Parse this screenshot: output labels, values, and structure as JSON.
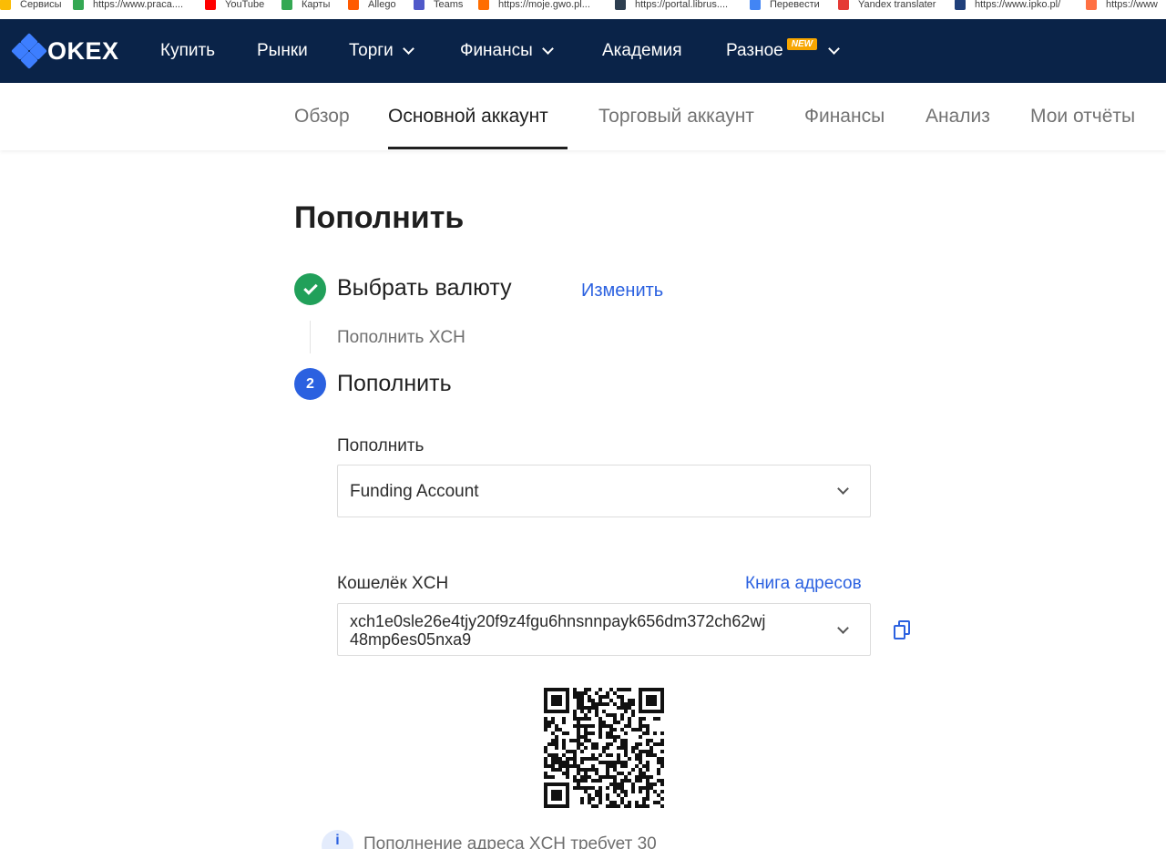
{
  "bookmarks": [
    {
      "label": "Сервисы",
      "color": "#fbbc05",
      "icon": "apps-icon"
    },
    {
      "label": "https://www.praca....",
      "color": "#34a853",
      "icon": "page-icon"
    },
    {
      "label": "YouTube",
      "color": "#ff0000",
      "icon": "youtube-icon"
    },
    {
      "label": "Карты",
      "color": "#34a853",
      "icon": "maps-icon"
    },
    {
      "label": "Allego",
      "color": "#ff5a00",
      "icon": "allegro-icon"
    },
    {
      "label": "Teams",
      "color": "#5059c9",
      "icon": "teams-icon"
    },
    {
      "label": "https://moje.gwo.pl...",
      "color": "#ff6d00",
      "icon": "page-icon"
    },
    {
      "label": "https://portal.librus....",
      "color": "#2d3e50",
      "icon": "page-icon"
    },
    {
      "label": "Перевести",
      "color": "#4285f4",
      "icon": "translate-icon"
    },
    {
      "label": "Yandex translater",
      "color": "#e53935",
      "icon": "yandex-icon"
    },
    {
      "label": "https://www.ipko.pl/",
      "color": "#1f3f7a",
      "icon": "page-icon"
    },
    {
      "label": "https://www",
      "color": "#ff7043",
      "icon": "page-icon"
    }
  ],
  "brand": {
    "logo_text": "OKEX",
    "accent": "#3d7eff",
    "nav_bg": "#0a2348"
  },
  "topnav": {
    "items": [
      {
        "label": "Купить",
        "has_dropdown": false
      },
      {
        "label": "Рынки",
        "has_dropdown": false
      },
      {
        "label": "Торги",
        "has_dropdown": true
      },
      {
        "label": "Финансы",
        "has_dropdown": true
      },
      {
        "label": "Академия",
        "has_dropdown": false
      },
      {
        "label": "Разное",
        "has_dropdown": true,
        "badge": "NEW"
      }
    ]
  },
  "subnav": {
    "tabs": [
      "Обзор",
      "Основной аккаунт",
      "Торговый аккаунт",
      "Финансы",
      "Анализ",
      "Мои отчёты"
    ],
    "active": "Основной аккаунт"
  },
  "page": {
    "title": "Пополнить",
    "step1": {
      "title": "Выбрать валюту",
      "change_link": "Изменить",
      "summary": "Пополнить XCH",
      "status": "done"
    },
    "step2": {
      "number": "2",
      "title": "Пополнить"
    },
    "deposit_to": {
      "label": "Пополнить",
      "value": "Funding Account"
    },
    "wallet": {
      "label": "Кошелёк XCH",
      "address_book_link": "Книга адресов",
      "address_line1": "xch1e0sle26e4tjy20f9z4fgu6hnsnnpayk656dm372ch62wj",
      "address_line2": "48mp6es05nxa9"
    },
    "info_text": "Пополнение адреса XCH требует 30"
  },
  "colors": {
    "link": "#2b61e0",
    "success": "#21a05a",
    "step_active": "#2b61e0",
    "badge": "#f7a600"
  }
}
